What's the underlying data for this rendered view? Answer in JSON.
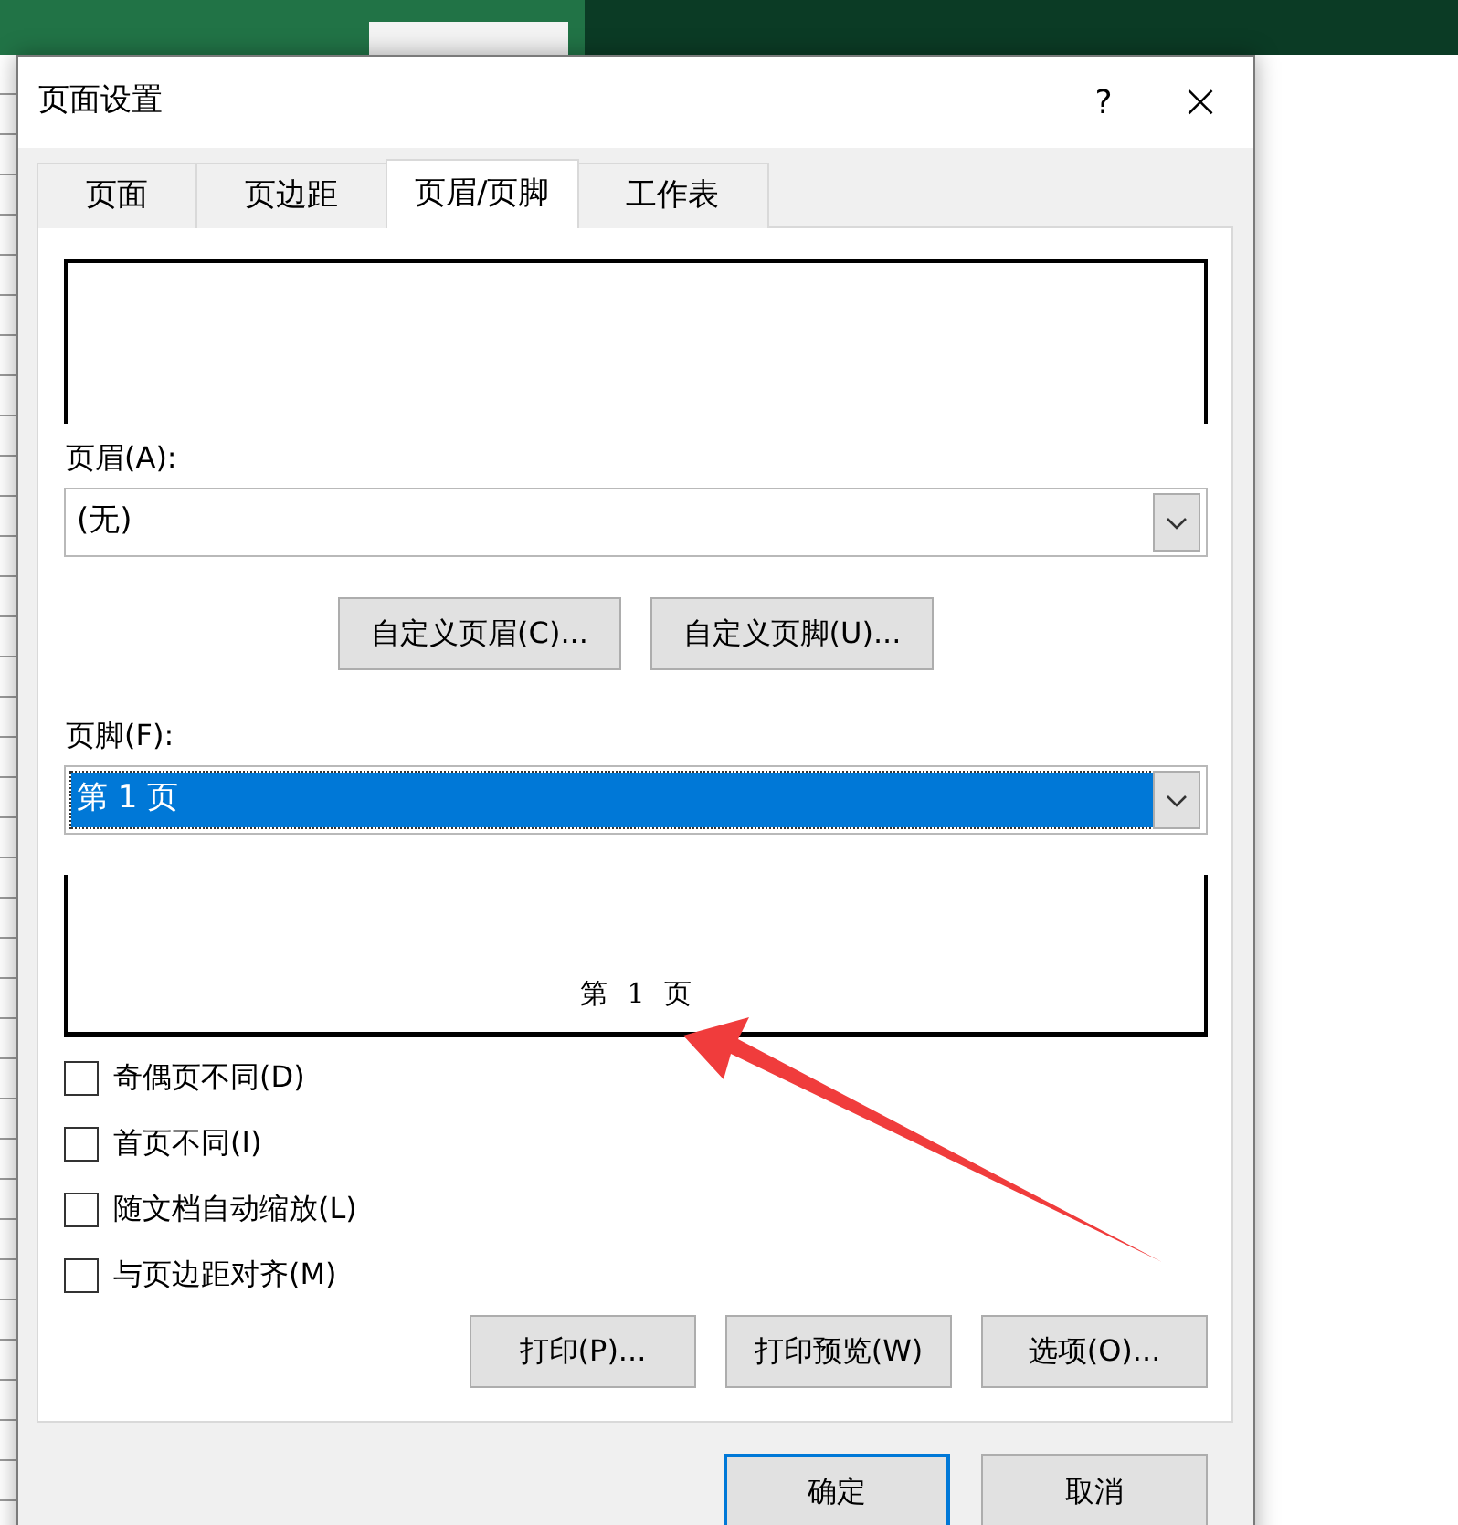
{
  "dialog": {
    "title": "页面设置",
    "help": "?",
    "close": "×"
  },
  "tabs": [
    {
      "label": "页面",
      "selected": false
    },
    {
      "label": "页边距",
      "selected": false
    },
    {
      "label": "页眉/页脚",
      "selected": true
    },
    {
      "label": "工作表",
      "selected": false
    }
  ],
  "header": {
    "label": "页眉(A):",
    "value": "(无)",
    "selected": false
  },
  "custom_buttons": [
    "自定义页眉(C)...",
    "自定义页脚(U)..."
  ],
  "footer": {
    "label": "页脚(F):",
    "value": "第 1 页",
    "selected": true,
    "preview": "第 1 页"
  },
  "checkboxes": [
    {
      "label": "奇偶页不同(D)",
      "checked": false
    },
    {
      "label": "首页不同(I)",
      "checked": false
    },
    {
      "label": "随文档自动缩放(L)",
      "checked": false
    },
    {
      "label": "与页边距对齐(M)",
      "checked": false
    }
  ],
  "panel_buttons": [
    "打印(P)...",
    "打印预览(W)",
    "选项(O)..."
  ],
  "dialog_buttons": [
    {
      "label": "确定",
      "default": true
    },
    {
      "label": "取消",
      "default": false
    }
  ]
}
